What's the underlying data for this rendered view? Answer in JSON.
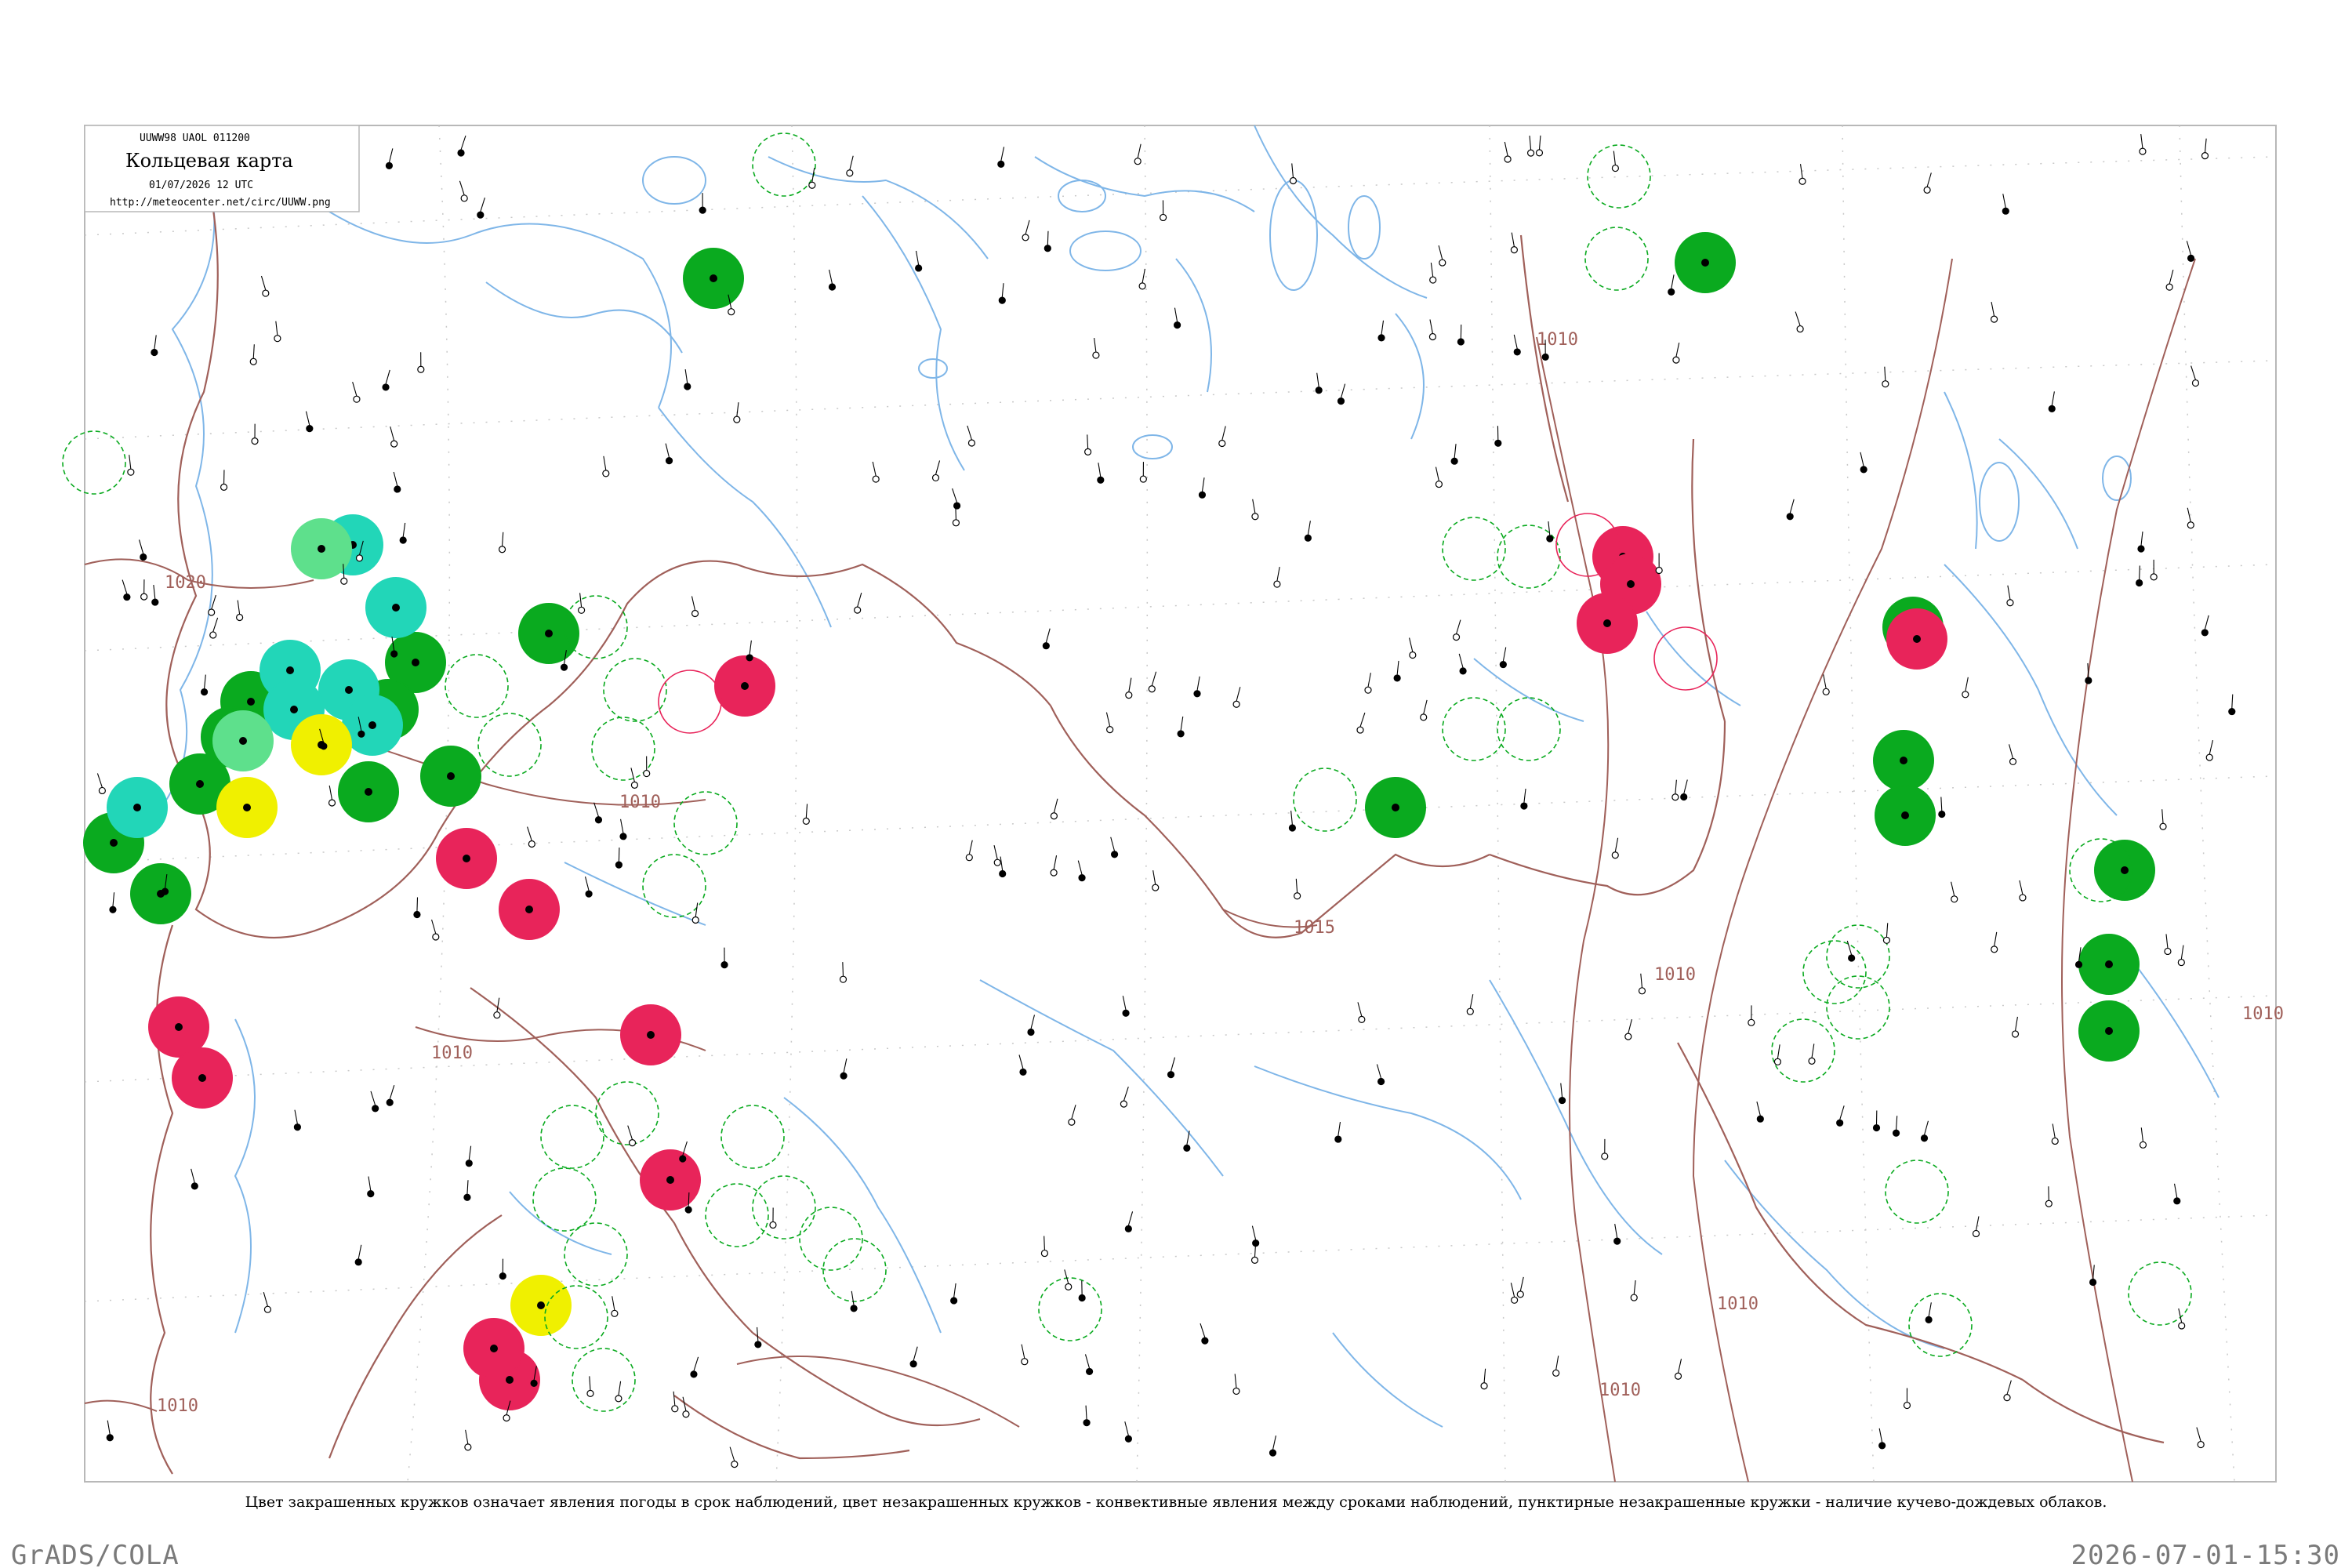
{
  "header": {
    "code_line": "UUWW98  UAOL  011200",
    "title": "Кольцевая карта",
    "date_line": "01/07/2026 12 UTC",
    "url": "http://meteocenter.net/circ/UUWW.png"
  },
  "isobars": [
    "1010",
    "1015",
    "1010",
    "1010",
    "1010",
    "1010",
    "1010",
    "1010",
    "1020",
    "1010"
  ],
  "caption": "Цвет закрашенных кружков означает явления погоды в срок наблюдений, цвет незакрашенных кружков - конвективные явления между сроками наблюдений, пунктирные незакрашенные кружки - наличие кучево-дождевых облаков.",
  "footer": {
    "left": "GrADS/COLA",
    "right": "2026-07-01-15:30"
  },
  "colors": {
    "frame": "#b8b8b8",
    "coast": "#7fb6e8",
    "border": "#a0605a",
    "grid": "#bdbdbd",
    "green": "#0aaa1f",
    "cyan": "#22d6b8",
    "light_green": "#5ee08c",
    "red": "#e8245a",
    "yellow": "#f0f000",
    "station": "#000000"
  }
}
